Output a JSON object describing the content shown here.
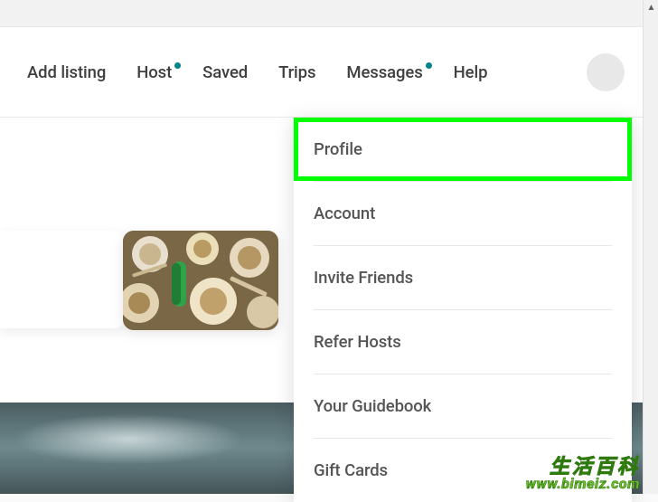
{
  "header": {
    "nav": [
      {
        "label": "Add listing",
        "dot": false
      },
      {
        "label": "Host",
        "dot": true
      },
      {
        "label": "Saved",
        "dot": false
      },
      {
        "label": "Trips",
        "dot": false
      },
      {
        "label": "Messages",
        "dot": true
      },
      {
        "label": "Help",
        "dot": false
      }
    ]
  },
  "dropdown": {
    "items": [
      {
        "label": "Profile",
        "highlighted": true
      },
      {
        "label": "Account",
        "highlighted": false
      },
      {
        "label": "Invite Friends",
        "highlighted": false
      },
      {
        "label": "Refer Hosts",
        "highlighted": false
      },
      {
        "label": "Your Guidebook",
        "highlighted": false
      },
      {
        "label": "Gift Cards",
        "highlighted": false
      }
    ]
  },
  "watermark": {
    "line1": "生活百科",
    "line2": "www.bimeiz.com"
  }
}
